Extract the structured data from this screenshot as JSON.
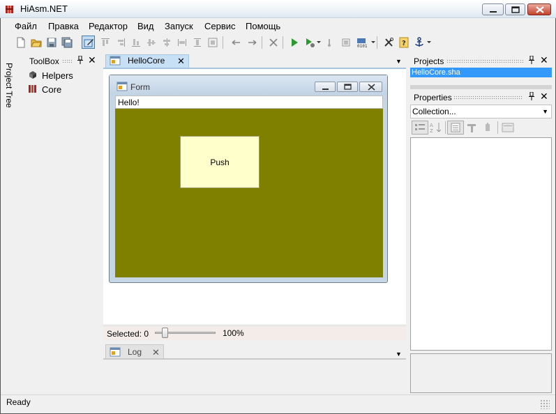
{
  "app": {
    "title": "HiAsm.NET"
  },
  "menu": [
    "Файл",
    "Правка",
    "Редактор",
    "Вид",
    "Запуск",
    "Сервис",
    "Помощь"
  ],
  "side_strip": {
    "label": "Project Tree"
  },
  "toolbox": {
    "title": "ToolBox",
    "pin": "📌",
    "close": "✕",
    "items": [
      {
        "label": "Helpers"
      },
      {
        "label": "Core"
      }
    ]
  },
  "document": {
    "tab_label": "HelloCore",
    "tab_close": "✕",
    "dropdown": "▼",
    "form": {
      "title": "Form",
      "edit_text": "Hello!",
      "button_text": "Push",
      "client_color": "#808000"
    },
    "status": {
      "selected": "Selected: 0",
      "zoom": "100%",
      "zoom_fraction": 0.13
    }
  },
  "log": {
    "tab_label": "Log",
    "tab_close": "✕",
    "dropdown": "▼"
  },
  "projects": {
    "title": "Projects",
    "pin": "📌",
    "close": "✕",
    "items": [
      "HelloCore.sha"
    ]
  },
  "properties": {
    "title": "Properties",
    "pin": "📌",
    "close": "✕",
    "combo_value": "Collection...",
    "combo_arrow": "▼"
  },
  "statusbar": {
    "text": "Ready"
  },
  "colors": {
    "selection": "#3399ff",
    "doc_tab": "#c8e0f6",
    "form_client": "#808000",
    "button_face": "#ffffcc"
  }
}
